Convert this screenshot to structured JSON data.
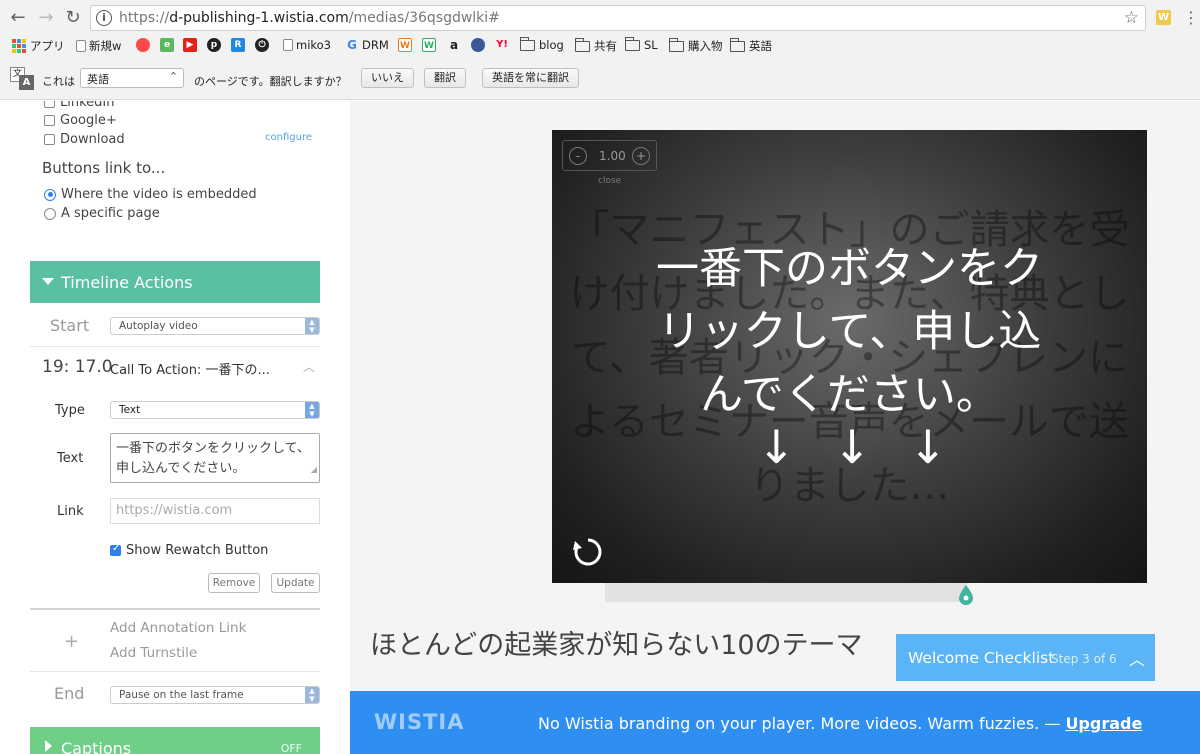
{
  "browser": {
    "url_prefix": "https://",
    "url_host": "d-publishing-1.wistia.com",
    "url_path": "/medias/36qsgdwlki#",
    "ext_badge": "W"
  },
  "bookmarks": [
    {
      "label": "アプリ",
      "icon": "apps-icon"
    },
    {
      "label": "新規w",
      "icon": "page-icon"
    },
    {
      "label": "",
      "icon": "red-bubble-icon"
    },
    {
      "label": "",
      "icon": "evernote-icon"
    },
    {
      "label": "",
      "icon": "youtube-icon"
    },
    {
      "label": "",
      "icon": "pinterest-icon"
    },
    {
      "label": "",
      "icon": "pocket-icon"
    },
    {
      "label": "",
      "icon": "power-icon"
    },
    {
      "label": "miko3",
      "icon": "page-icon"
    },
    {
      "label": "DRM",
      "icon": "google-icon"
    },
    {
      "label": "W",
      "icon": "w-orange-icon"
    },
    {
      "label": "W",
      "icon": "w-green-icon"
    },
    {
      "label": "a",
      "icon": "amazon-icon"
    },
    {
      "label": "",
      "icon": "bird-icon"
    },
    {
      "label": "Y!",
      "icon": "yahoo-icon"
    },
    {
      "label": "blog",
      "icon": "folder-icon"
    },
    {
      "label": "共有",
      "icon": "folder-icon"
    },
    {
      "label": "SL",
      "icon": "folder-icon"
    },
    {
      "label": "購入物",
      "icon": "folder-icon"
    },
    {
      "label": "英語",
      "icon": "folder-icon"
    }
  ],
  "translate": {
    "prefix": "これは",
    "language": "英語",
    "question": "のページです。翻訳しますか？",
    "no": "いいえ",
    "translate": "翻訳",
    "always": "英語を常に翻訳"
  },
  "sidebar": {
    "social": [
      {
        "label": "LinkedIn",
        "checked": false
      },
      {
        "label": "Google+",
        "checked": false
      },
      {
        "label": "Download",
        "checked": false
      }
    ],
    "configure": "configure",
    "buttons_link_to": "Buttons link to...",
    "link_options": [
      {
        "label": "Where the video is embedded",
        "selected": true
      },
      {
        "label": "A specific page",
        "selected": false
      }
    ],
    "timeline_title": "Timeline Actions",
    "start_label": "Start",
    "start_value": "Autoplay video",
    "cta": {
      "time": "19: 17.0",
      "title": "Call To Action: 一番下の...",
      "type_label": "Type",
      "type_value": "Text",
      "text_label": "Text",
      "text_value": "一番下のボタンをクリックして、申し込んでください。",
      "link_label": "Link",
      "link_placeholder": "https://wistia.com",
      "rewatch_label": "Show Rewatch Button",
      "rewatch_checked": true,
      "remove": "Remove",
      "update": "Update"
    },
    "add_annotation": "Add Annotation Link",
    "add_turnstile": "Add Turnstile",
    "end_label": "End",
    "end_value": "Pause on the last frame",
    "captions_title": "Captions",
    "captions_state": "OFF"
  },
  "player": {
    "speed": "1.00",
    "speed_close": "close",
    "background_text": "「マニフェスト」のご請求を受け付けました。また、特典として、著者リック・シェフレンによるセミナー音声をメールで送りました…",
    "cta_line1": "一番下のボタンをク",
    "cta_line2": "リックして、申し込",
    "cta_line3": "んでください。",
    "arrows": [
      "↓",
      "↓",
      "↓"
    ],
    "progress": 0.65
  },
  "video_title": "ほとんどの起業家が知らない10のテーマ",
  "checklist": {
    "title": "Welcome Checklist",
    "step": "Step 3 of 6"
  },
  "promo": {
    "logo": "WISTIA",
    "message": "No Wistia branding on your player. More videos. Warm fuzzies. —",
    "link": "Upgrade"
  },
  "colors": {
    "timeline_header": "#5bbfa3",
    "captions_header": "#6fcf87",
    "checklist": "#5bb4f5",
    "promo": "#2f8ef2"
  }
}
